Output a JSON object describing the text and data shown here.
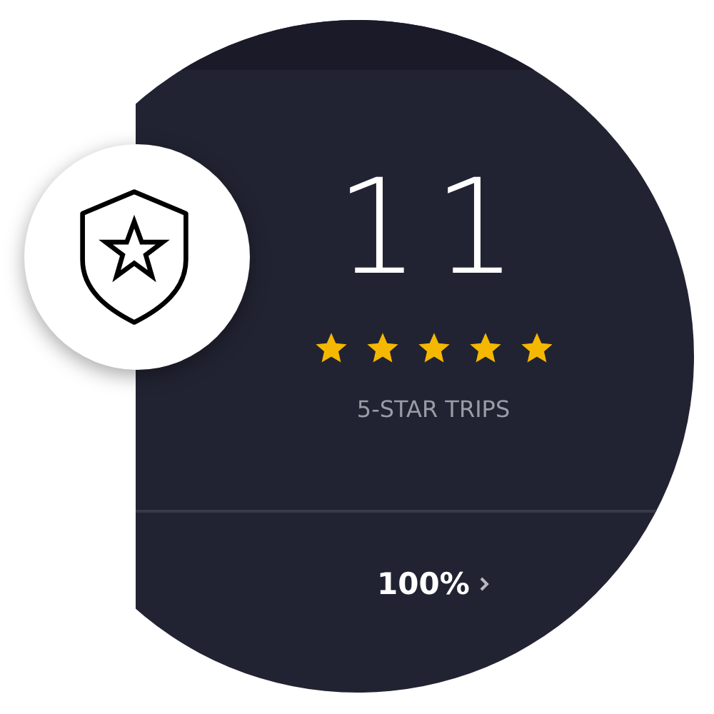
{
  "count": "11",
  "rating": {
    "stars": 5
  },
  "caption": "5-STAR TRIPS",
  "percentage": "100%"
}
